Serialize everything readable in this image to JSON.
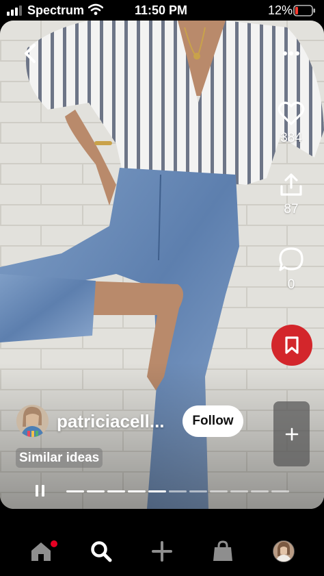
{
  "status_bar": {
    "carrier": "Spectrum",
    "time": "11:50 PM",
    "battery_percent": "12%",
    "icons": [
      "signal-icon",
      "wifi-icon",
      "battery-icon"
    ]
  },
  "pin": {
    "image_description_icon": "photo",
    "stats": {
      "likes": "384",
      "shares": "87",
      "comments": "0"
    },
    "creator": {
      "name": "patriciacell...",
      "follow_label": "Follow"
    },
    "similar_label": "Similar ideas",
    "video_progress": 0.5,
    "progress_segments": 11,
    "progress_done_segments": 5
  },
  "nav": {
    "items": [
      "home-icon",
      "search-icon",
      "create-icon",
      "shop-icon",
      "profile-avatar"
    ]
  },
  "colors": {
    "save_red": "#d3262b",
    "notification_red": "#e60023"
  }
}
